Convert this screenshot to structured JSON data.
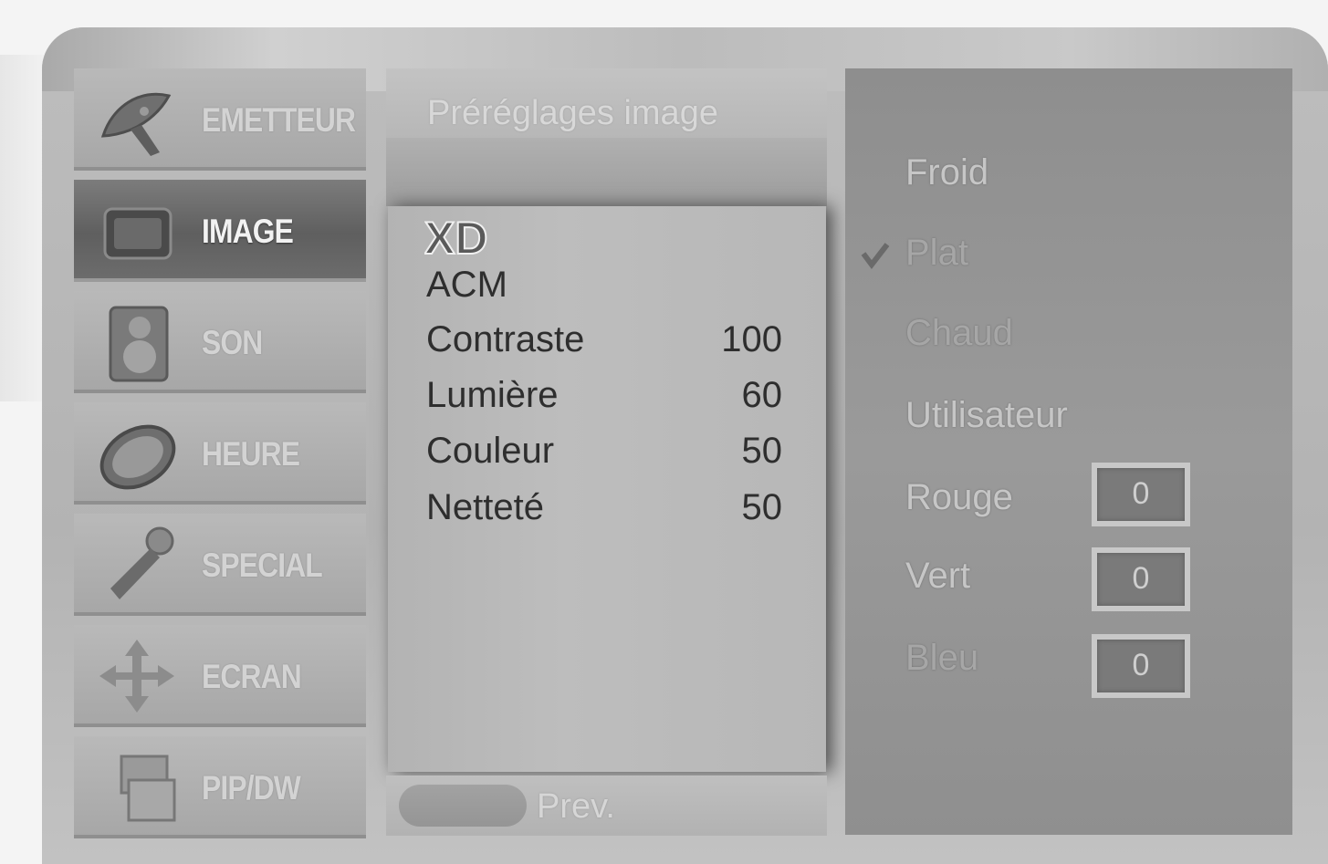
{
  "sidebar": {
    "items": [
      {
        "label": "EMETTEUR",
        "icon": "satellite-dish-icon",
        "active": false
      },
      {
        "label": "IMAGE",
        "icon": "tv-screen-icon",
        "active": true
      },
      {
        "label": "SON",
        "icon": "speaker-icon",
        "active": false
      },
      {
        "label": "HEURE",
        "icon": "clock-icon",
        "active": false
      },
      {
        "label": "SPECIAL",
        "icon": "tools-icon",
        "active": false
      },
      {
        "label": "ECRAN",
        "icon": "move-arrows-icon",
        "active": false
      },
      {
        "label": "PIP/DW",
        "icon": "pip-windows-icon",
        "active": false
      }
    ]
  },
  "middle": {
    "title": "Préréglages image",
    "logo": "XD",
    "acm": "ACM",
    "rows": [
      {
        "name": "Contraste",
        "value": "100"
      },
      {
        "name": "Lumière",
        "value": "60"
      },
      {
        "name": "Couleur",
        "value": "50"
      },
      {
        "name": "Netteté",
        "value": "50"
      }
    ],
    "prev_label": "Prev."
  },
  "right": {
    "options": [
      "Froid",
      "Plat",
      "Chaud",
      "Utilisateur"
    ],
    "selected": "Plat",
    "channels": [
      {
        "name": "Rouge",
        "value": "0"
      },
      {
        "name": "Vert",
        "value": "0"
      },
      {
        "name": "Bleu",
        "value": "0"
      }
    ]
  }
}
